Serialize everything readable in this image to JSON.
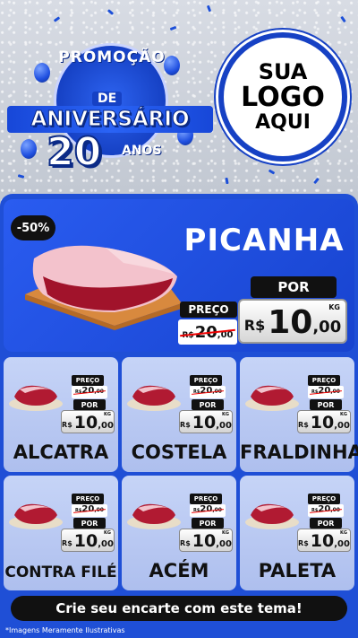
{
  "header": {
    "promo_top": "PROMOÇÃO",
    "promo_de": "DE",
    "promo_main": "ANIVERSÁRIO",
    "promo_number": "20",
    "promo_anos": "ANOS",
    "logo_line1": "SUA",
    "logo_line2": "LOGO",
    "logo_line3": "AQUI"
  },
  "featured": {
    "discount": "-50%",
    "name": "PICANHA",
    "preco_label": "PREÇO",
    "por_label": "POR",
    "old_currency": "R$",
    "old_int": "20",
    "old_dec": ",00",
    "new_currency": "R$",
    "new_int": "10",
    "new_dec": ",00",
    "unit": "KG"
  },
  "products": [
    {
      "name": "ALCATRA",
      "preco_label": "PREÇO",
      "por_label": "POR",
      "old_currency": "R$",
      "old_int": "20",
      "old_dec": ",00",
      "new_currency": "R$",
      "new_int": "10",
      "new_dec": ",00",
      "unit": "KG"
    },
    {
      "name": "COSTELA",
      "preco_label": "PREÇO",
      "por_label": "POR",
      "old_currency": "R$",
      "old_int": "20",
      "old_dec": ",00",
      "new_currency": "R$",
      "new_int": "10",
      "new_dec": ",00",
      "unit": "KG"
    },
    {
      "name": "FRALDINHA",
      "preco_label": "PREÇO",
      "por_label": "POR",
      "old_currency": "R$",
      "old_int": "20",
      "old_dec": ",00",
      "new_currency": "R$",
      "new_int": "10",
      "new_dec": ",00",
      "unit": "KG"
    },
    {
      "name": "CONTRA FILÉ",
      "preco_label": "PREÇO",
      "por_label": "POR",
      "old_currency": "R$",
      "old_int": "20",
      "old_dec": ",00",
      "new_currency": "R$",
      "new_int": "10",
      "new_dec": ",00",
      "unit": "KG"
    },
    {
      "name": "ACÉM",
      "preco_label": "PREÇO",
      "por_label": "POR",
      "old_currency": "R$",
      "old_int": "20",
      "old_dec": ",00",
      "new_currency": "R$",
      "new_int": "10",
      "new_dec": ",00",
      "unit": "KG"
    },
    {
      "name": "PALETA",
      "preco_label": "PREÇO",
      "por_label": "POR",
      "old_currency": "R$",
      "old_int": "20",
      "old_dec": ",00",
      "new_currency": "R$",
      "new_int": "10",
      "new_dec": ",00",
      "unit": "KG"
    }
  ],
  "cta": {
    "label": "Crie seu encarte com este tema!"
  },
  "footer": {
    "disclaimer": "*Imagens Meramente Ilustrativas"
  },
  "colors": {
    "brand_blue": "#1f4fd6",
    "card_bg": "#c6d4f7",
    "tag_black": "#111111",
    "strike_red": "#e00000"
  },
  "icons": {
    "meat": "meat-cut-icon",
    "confetti": "confetti-icon",
    "balloon": "balloon-icon"
  }
}
